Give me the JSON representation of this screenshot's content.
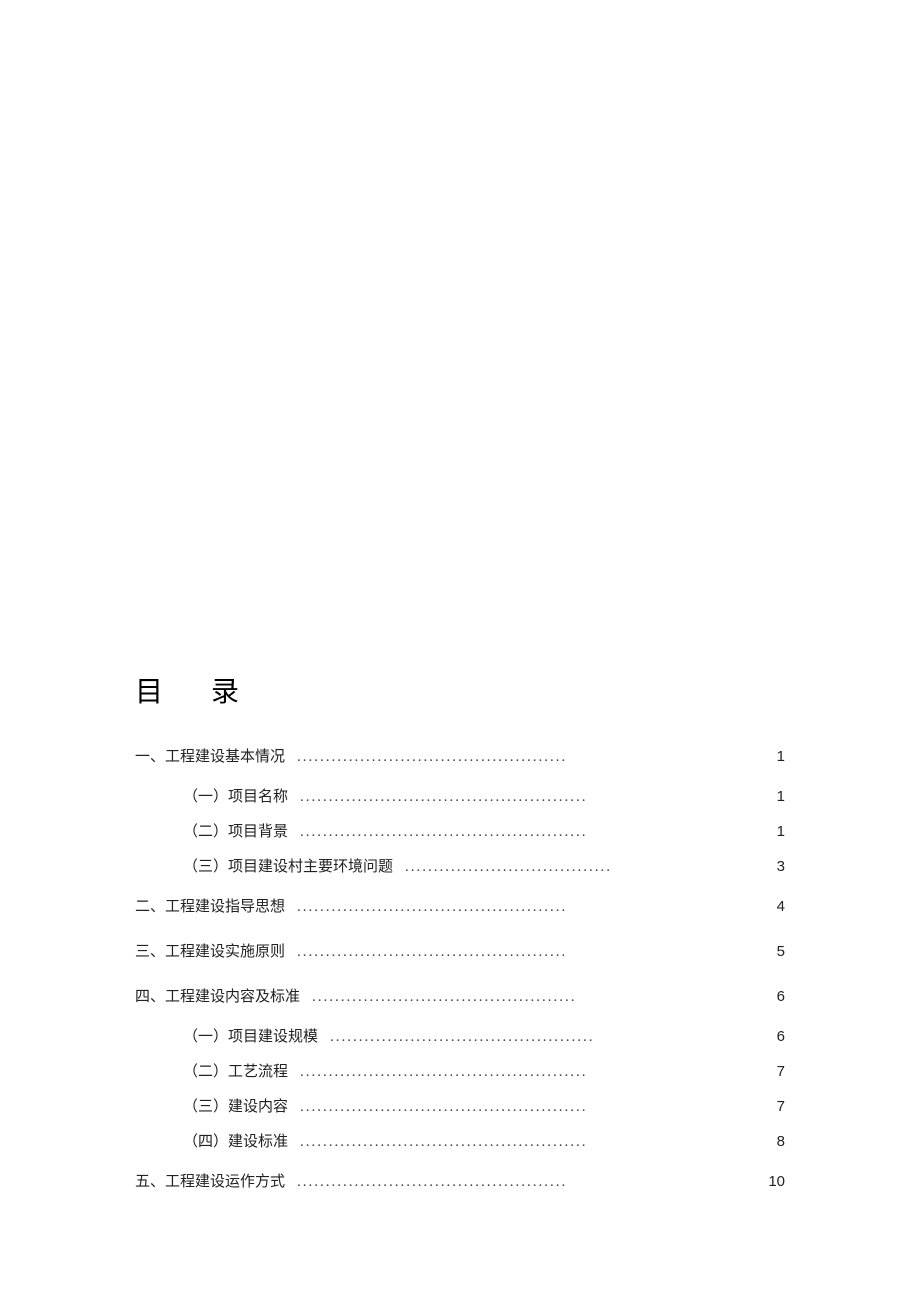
{
  "title": "目录",
  "toc": [
    {
      "level": 1,
      "label": "一、工程建设基本情况",
      "leader": "...............................................",
      "page": "1"
    },
    {
      "level": 2,
      "label": "（一）项目名称",
      "leader": "..................................................",
      "page": "1"
    },
    {
      "level": 2,
      "label": "（二）项目背景",
      "leader": "..................................................",
      "page": "1"
    },
    {
      "level": 2,
      "label": "（三）项目建设村主要环境问题",
      "leader": "....................................",
      "page": "3"
    },
    {
      "level": 1,
      "label": "二、工程建设指导思想",
      "leader": "...............................................",
      "page": "4"
    },
    {
      "level": 1,
      "label": "三、工程建设实施原则",
      "leader": "...............................................",
      "page": "5"
    },
    {
      "level": 1,
      "label": "四、工程建设内容及标准",
      "leader": "..............................................",
      "page": "6"
    },
    {
      "level": 2,
      "label": "（一）项目建设规模",
      "leader": "..............................................",
      "page": "6"
    },
    {
      "level": 2,
      "label": "（二）工艺流程",
      "leader": "..................................................",
      "page": "7"
    },
    {
      "level": 2,
      "label": "（三）建设内容",
      "leader": "..................................................",
      "page": "7"
    },
    {
      "level": 2,
      "label": "（四）建设标准",
      "leader": "..................................................",
      "page": "8"
    },
    {
      "level": 1,
      "label": "五、工程建设运作方式",
      "leader": "...............................................",
      "page": "10"
    }
  ]
}
